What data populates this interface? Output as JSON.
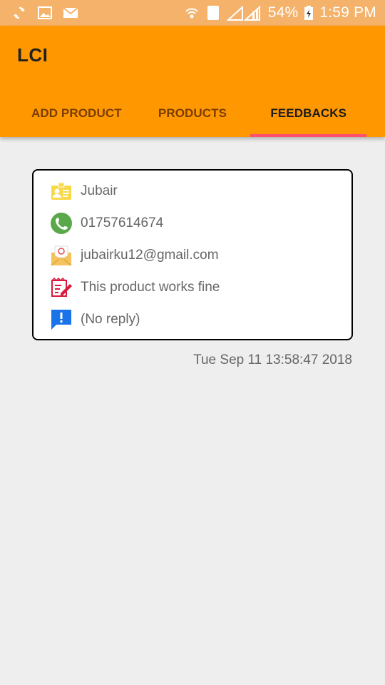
{
  "status_bar": {
    "battery": "54%",
    "time": "1:59 PM",
    "sim_slot": "2"
  },
  "app": {
    "title": "LCI"
  },
  "tabs": [
    {
      "label": "ADD PRODUCT"
    },
    {
      "label": "PRODUCTS"
    },
    {
      "label": "FEEDBACKS"
    }
  ],
  "feedback": {
    "name": "Jubair",
    "phone": "01757614674",
    "email": "jubairku12@gmail.com",
    "message": "This product works fine",
    "reply": "(No reply)",
    "timestamp": "Tue Sep 11 13:58:47 2018"
  }
}
